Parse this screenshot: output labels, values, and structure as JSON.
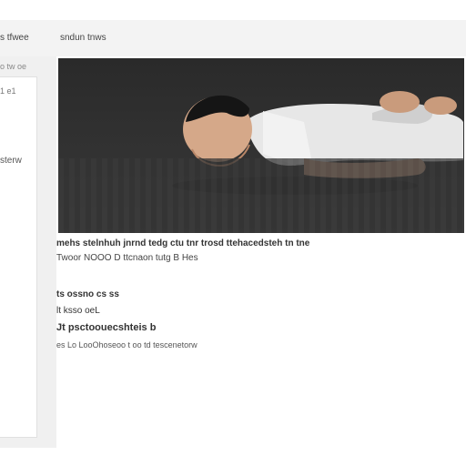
{
  "header": {
    "site_name": "s tfwee",
    "nav_label": "sndun tnws"
  },
  "sidebar": {
    "subheading": "o tw oe",
    "top_label": "1 e1",
    "label": "sterw"
  },
  "main": {
    "photo": {
      "icon": "photo-icon"
    },
    "caption": {
      "line1": "mehs stelnhuh jnrnd tedg ctu tnr trosd ttehacedsteh tn tne",
      "line2": "Twoor NOOO D ttcnaon tutg  B  Hes"
    },
    "details": {
      "line1": "ts ossno cs  ss",
      "line2": "lt ksso oeL",
      "line3": "Jt psctoouecshteis b",
      "line4": "es Lo LooOhoseoo t oo td tescenetorw"
    }
  },
  "colors": {
    "window_background": "#f7f7f7",
    "panel_background": "#ffffff",
    "photo_background": "#2f2f2f"
  }
}
